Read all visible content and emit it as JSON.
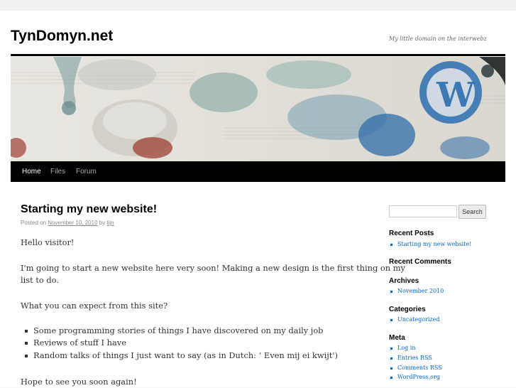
{
  "site": {
    "title": "TynDomyn.net",
    "description": "My little domain on the interwebz"
  },
  "nav": {
    "items": [
      {
        "label": "Home",
        "current": true
      },
      {
        "label": "Files",
        "current": false
      },
      {
        "label": "Forum",
        "current": false
      }
    ]
  },
  "post": {
    "title": "Starting my new website!",
    "meta_prefix": "Posted on",
    "date": "November 10, 2010",
    "by": "by",
    "author": "tijn",
    "paragraphs": [
      "Hello visitor!",
      "I'm going to start a new website here very soon! Making a new design is the first thing on my",
      "list to do.",
      "What you can expect from this site?"
    ],
    "list": [
      "Some programming stories of things I have discovered on my daily job",
      "Reviews of stuff I have",
      "Random talks of things I just want to say (as in Dutch: ‘ Even mij ei kwijt')"
    ],
    "closing": "Hope to see you soon again!"
  },
  "sidebar": {
    "search": {
      "placeholder": "",
      "button": "Search"
    },
    "recent_posts": {
      "title": "Recent Posts",
      "items": [
        "Starting my new website!"
      ]
    },
    "recent_comments": {
      "title": "Recent Comments"
    },
    "archives": {
      "title": "Archives",
      "items": [
        "November 2010"
      ]
    },
    "categories": {
      "title": "Categories",
      "items": [
        "Uncategorized"
      ]
    },
    "meta": {
      "title": "Meta",
      "items": [
        "Log in",
        "Entries RSS",
        "Comments RSS",
        "WordPress.org"
      ]
    }
  },
  "colors": {
    "link": "#0066cc",
    "nav_bg": "#000000"
  },
  "icons": {
    "banner": "watercolor-splash-wordpress-logo"
  }
}
